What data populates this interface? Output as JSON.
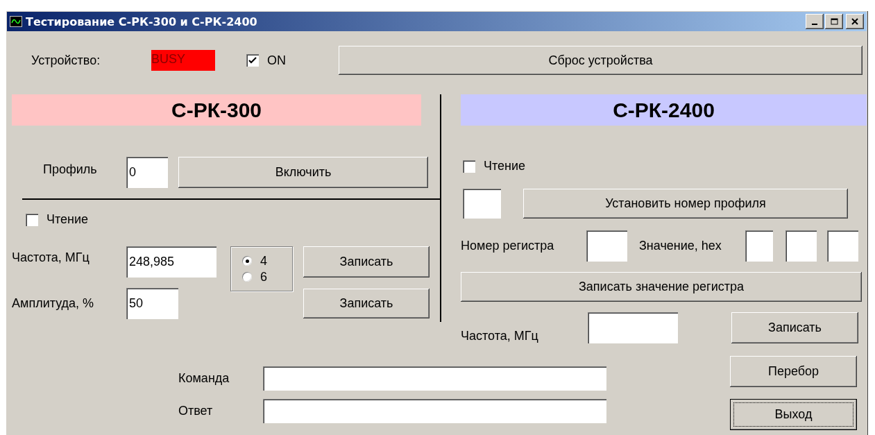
{
  "window": {
    "title": "Тестирование С-РК-300 и С-РК-2400"
  },
  "device": {
    "label": "Устройство:",
    "status": "BUSY",
    "on_checkbox": {
      "label": "ON",
      "checked": true
    },
    "reset_button": "Сброс устройства"
  },
  "left_panel": {
    "title": "С-РК-300",
    "profile": {
      "label": "Профиль",
      "value": "0",
      "button": "Включить"
    },
    "read_checkbox": {
      "label": "Чтение",
      "checked": false
    },
    "frequency": {
      "label": "Частота, МГц",
      "value": "248,985",
      "button": "Записать"
    },
    "options": [
      {
        "label": "4",
        "selected": true
      },
      {
        "label": "6",
        "selected": false
      }
    ],
    "amplitude": {
      "label": "Амплитуда, %",
      "value": "50",
      "button": "Записать"
    }
  },
  "right_panel": {
    "title": "С-РК-2400",
    "read_checkbox": {
      "label": "Чтение",
      "checked": false
    },
    "profile_button": "Установить номер профиля",
    "register_label": "Номер регистра",
    "value_label": "Значение, hex",
    "write_register_button": "Записать значение регистра",
    "frequency": {
      "label": "Частота, МГц",
      "button": "Записать"
    }
  },
  "command": {
    "label": "Команда"
  },
  "response": {
    "label": "Ответ"
  },
  "buttons": [
    {
      "label": "Перебор",
      "focused": false
    },
    {
      "label": "Выход",
      "focused": true
    }
  ]
}
